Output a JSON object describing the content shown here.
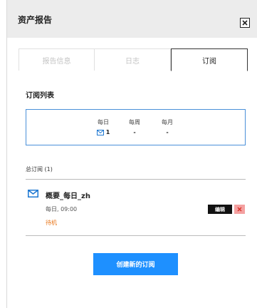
{
  "header": {
    "title": "资产报告"
  },
  "tabs": [
    {
      "label": "报告信息"
    },
    {
      "label": "日志"
    },
    {
      "label": "订阅"
    }
  ],
  "subscriptions": {
    "title": "订阅列表",
    "columns": [
      {
        "label": "每日",
        "value": "1",
        "icon": "mail-icon"
      },
      {
        "label": "每周",
        "value": "-"
      },
      {
        "label": "每月",
        "value": "-"
      }
    ],
    "total_label": "总订阅 (1)",
    "items": [
      {
        "name": "概要_每日_zh",
        "schedule": "每日, 09:00",
        "status": "待机",
        "icon": "mail-icon"
      }
    ]
  },
  "actions": {
    "edit": "编辑",
    "create": "创建新的订阅"
  },
  "colors": {
    "accent": "#1e90ff",
    "box_border": "#4a90d9",
    "status": "#e8761a",
    "delete_bg": "#f4a1a1",
    "delete_x": "#d9342b"
  }
}
